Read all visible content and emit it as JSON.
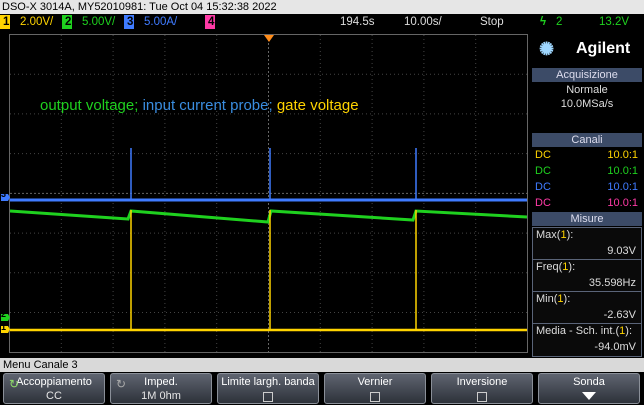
{
  "title_bar": "DSO-X 3014A, MY52010981: Tue Oct 04 15:32:38 2022",
  "status": {
    "ch1_num": "1",
    "ch1_scale": "2.00V/",
    "ch2_num": "2",
    "ch2_scale": "5.00V/",
    "ch3_num": "3",
    "ch3_scale": "5.00A/",
    "ch4_num": "4",
    "time_offset": "194.5s",
    "time_scale": "10.00s/",
    "run_state": "Stop",
    "trigger_icon": "ϟ",
    "trigger_ch": "2",
    "trigger_level": "13.2V"
  },
  "brand": "Agilent",
  "acquisition": {
    "header": "Acquisizione",
    "mode": "Normale",
    "rate": "10.0MSa/s"
  },
  "channels": {
    "header": "Canali",
    "rows": [
      {
        "coupling": "DC",
        "ratio": "10.0:1"
      },
      {
        "coupling": "DC",
        "ratio": "10.0:1"
      },
      {
        "coupling": "DC",
        "ratio": "10.0:1"
      },
      {
        "coupling": "DC",
        "ratio": "10.0:1"
      }
    ]
  },
  "measurements": {
    "header": "Misure",
    "items": [
      {
        "label": "Max",
        "channel": "1",
        "value": "9.03V"
      },
      {
        "label": "Freq",
        "channel": "1",
        "value": "35.598Hz"
      },
      {
        "label": "Min",
        "channel": "1",
        "value": "-2.63V"
      },
      {
        "label": "Media - Sch. int.",
        "channel": "1",
        "value": "-94.0mV"
      }
    ]
  },
  "caption": {
    "part1": "output voltage; ",
    "part2": "input current probe; ",
    "part3": "gate voltage"
  },
  "markers": {
    "ch3": "3",
    "ch2": "2",
    "ch1": "1"
  },
  "menu_title": "Menu Canale 3",
  "softkeys": [
    {
      "label": "Accoppiamento",
      "value": "CC"
    },
    {
      "label": "Imped.",
      "value": "1M 0hm"
    },
    {
      "label": "Limite largh. banda",
      "value": ""
    },
    {
      "label": "Vernier",
      "value": ""
    },
    {
      "label": "Inversione",
      "value": ""
    },
    {
      "label": "Sonda",
      "value": ""
    }
  ],
  "colors": {
    "ch1": "#ffd400",
    "ch2": "#1fd11f",
    "ch3": "#3f7bff",
    "ch4": "#ff3aa6",
    "caption_output": "#1fd11f",
    "caption_current": "#3a8de0",
    "caption_gate": "#ffd400"
  }
}
